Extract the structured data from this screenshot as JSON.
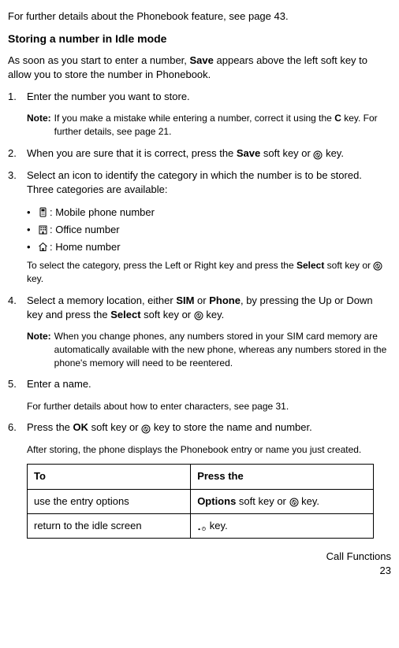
{
  "intro": "For further details about the Phonebook feature, see page 43.",
  "heading": "Storing a number in Idle mode",
  "lead_part1": "As soon as you start to enter a number, ",
  "lead_bold": "Save",
  "lead_part2": " appears above the left soft key to allow you to store the number in Phonebook.",
  "step1_num": "1.",
  "step1_text": "Enter the number you want to store.",
  "note1_label": "Note:",
  "note1_part1": "If you make a mistake while entering a number, correct it using the ",
  "note1_bold": "C",
  "note1_part2": " key. For further details, see page 21.",
  "step2_num": "2.",
  "step2_part1": "When you are sure that it is correct, press the ",
  "step2_bold": "Save",
  "step2_part2": " soft key or ",
  "step2_part3": " key.",
  "step3_num": "3.",
  "step3_text": "Select an icon to identify the category in which the number is to be stored. Three categories are available:",
  "bullet1": ": Mobile phone number",
  "bullet2": ": Office number",
  "bullet3": ": Home number",
  "select_part1": "To select the category, press the Left or Right key and press the ",
  "select_bold": "Select",
  "select_part2": " soft key or ",
  "select_part3": " key.",
  "step4_num": "4.",
  "step4_part1": "Select a memory location, either ",
  "step4_bold1": "SIM",
  "step4_part2": " or ",
  "step4_bold2": "Phone",
  "step4_part3": ", by pressing the Up or Down key and press the ",
  "step4_bold3": "Select",
  "step4_part4": " soft key or ",
  "step4_part5": " key.",
  "note2_label": "Note:",
  "note2_text": "When you change phones, any numbers stored in your SIM card memory are automatically available with the new phone, whereas any numbers stored in the phone's memory will need to be reentered.",
  "step5_num": "5.",
  "step5_text": "Enter a name.",
  "step5_sub": "For further details about how to enter characters, see page 31.",
  "step6_num": "6.",
  "step6_part1": "Press the ",
  "step6_bold": "OK",
  "step6_part2": " soft key or ",
  "step6_part3": " key to store the name and number.",
  "step6_sub": "After storing, the phone displays the Phonebook entry or name you just created.",
  "table": {
    "header1": "To",
    "header2": "Press the",
    "row1_col1": "use the entry options",
    "row1_col2_bold": "Options",
    "row1_col2_part2": " soft key or ",
    "row1_col2_part3": " key.",
    "row2_col1": "return to the idle screen",
    "row2_col2_part2": " key."
  },
  "footer1": "Call Functions",
  "footer2": "23"
}
